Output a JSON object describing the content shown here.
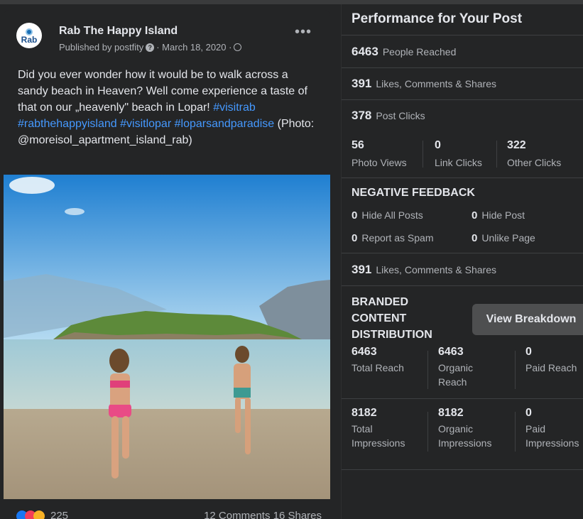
{
  "post": {
    "page_name": "Rab The Happy Island",
    "avatar_text": "Rab",
    "published_by": "Published by postfity",
    "date": "· March 18, 2020 ·",
    "more_label": "•••",
    "text_plain": "Did you ever wonder how it would be to walk across a sandy beach in Heaven? Well come experience a taste of that on our „heavenly\" beach in Lopar!",
    "hashtags": [
      "#visitrab",
      "#rabthehappyisland",
      "#visitlopar",
      "#loparsandparadise"
    ],
    "text_credit": "(Photo: @moreisol_apartment_island_rab)",
    "reaction_count": "225",
    "comments_shares": "12 Comments 16 Shares"
  },
  "panel": {
    "title": "Performance for Your Post",
    "people_reached": {
      "value": "6463",
      "label": "People Reached"
    },
    "likes_comments_shares": {
      "value": "391",
      "label": "Likes, Comments & Shares"
    },
    "post_clicks": {
      "value": "378",
      "label": "Post Clicks"
    },
    "clicks_breakdown": [
      {
        "value": "56",
        "label": "Photo Views"
      },
      {
        "value": "0",
        "label": "Link Clicks"
      },
      {
        "value": "322",
        "label": "Other Clicks"
      }
    ],
    "negative_feedback": {
      "title": "NEGATIVE FEEDBACK",
      "items": [
        {
          "value": "0",
          "label": "Hide All Posts"
        },
        {
          "value": "0",
          "label": "Hide Post"
        },
        {
          "value": "0",
          "label": "Report as Spam"
        },
        {
          "value": "0",
          "label": "Unlike Page"
        }
      ]
    },
    "likes_comments_shares_2": {
      "value": "391",
      "label": "Likes, Comments & Shares"
    },
    "branded": {
      "title": "BRANDED CONTENT DISTRIBUTION",
      "button": "View Breakdown",
      "reach": [
        {
          "value": "6463",
          "label": "Total Reach"
        },
        {
          "value": "6463",
          "label": "Organic Reach"
        },
        {
          "value": "0",
          "label": "Paid Reach"
        }
      ],
      "impressions": [
        {
          "value": "8182",
          "label": "Total Impressions"
        },
        {
          "value": "8182",
          "label": "Organic Impressions"
        },
        {
          "value": "0",
          "label": "Paid Impressions"
        }
      ]
    }
  },
  "colors": {
    "background": "#242526",
    "hashtag": "#4599ff",
    "text": "#e4e6eb",
    "muted": "#b0b3b8"
  },
  "icons": [
    "privacy-help-icon",
    "globe-icon",
    "more-options-icon",
    "like-reaction-icon",
    "love-reaction-icon",
    "wow-reaction-icon"
  ]
}
